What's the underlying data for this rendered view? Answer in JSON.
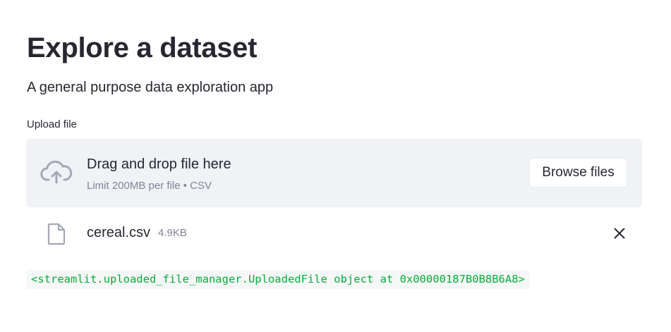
{
  "header": {
    "title": "Explore a dataset",
    "subtitle": "A general purpose data exploration app"
  },
  "uploader": {
    "label": "Upload file",
    "drop_title": "Drag and drop file here",
    "drop_limit": "Limit 200MB per file • CSV",
    "browse_label": "Browse files",
    "icon": "cloud-upload-icon"
  },
  "uploaded_file": {
    "name": "cereal.csv",
    "size": "4.9KB",
    "icon": "file-icon",
    "remove_icon": "close-icon"
  },
  "output": {
    "text": "<streamlit.uploaded_file_manager.UploadedFile object at 0x00000187B0B8B6A8>"
  },
  "colors": {
    "text": "#262730",
    "muted": "#808495",
    "dropzone_bg": "#f0f2f6",
    "code_text": "#09ab3b",
    "icon": "#a3a8b4"
  }
}
